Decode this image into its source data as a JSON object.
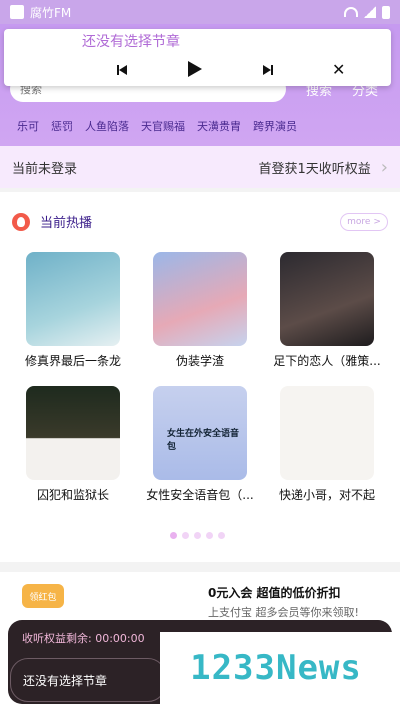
{
  "status_bar": {
    "app_name": "腐竹FM"
  },
  "player": {
    "title": "还没有选择节章",
    "controls": [
      "prev-icon",
      "play-icon",
      "next-icon",
      "close-icon"
    ]
  },
  "search": {
    "placeholder": "搜索",
    "search_label": "搜索",
    "category_label": "分类"
  },
  "tags": [
    "乐可",
    "惩罚",
    "人鱼陷落",
    "天官赐福",
    "天潢贵胄",
    "跨界演员"
  ],
  "login_bar": {
    "status": "当前未登录",
    "promo": "首登获1天收听权益"
  },
  "hot": {
    "title": "当前热播",
    "more": "more >"
  },
  "cards": [
    {
      "title": "修真界最后一条龙"
    },
    {
      "title": "伪装学渣"
    },
    {
      "title": "足下的恋人（雅策..."
    },
    {
      "title": "囚犯和监狱长"
    },
    {
      "title": "女性安全语音包（..."
    },
    {
      "title": "快递小哥，对不起"
    }
  ],
  "cover_texts": {
    "c5": "女生在外安全语音包"
  },
  "promo": {
    "badge": "领红包",
    "main": "0元入会 超值的低价折扣",
    "sub": "上支付宝 超多会员等你来领取!"
  },
  "mini_player": {
    "remaining": "收听权益剩余: 00:00:00",
    "now_playing": "还没有选择节章",
    "logo": "1233News"
  },
  "colors": {
    "accent": "#c69af0",
    "login_bg": "#f7eafd",
    "hot_title": "#3a1d8a"
  }
}
